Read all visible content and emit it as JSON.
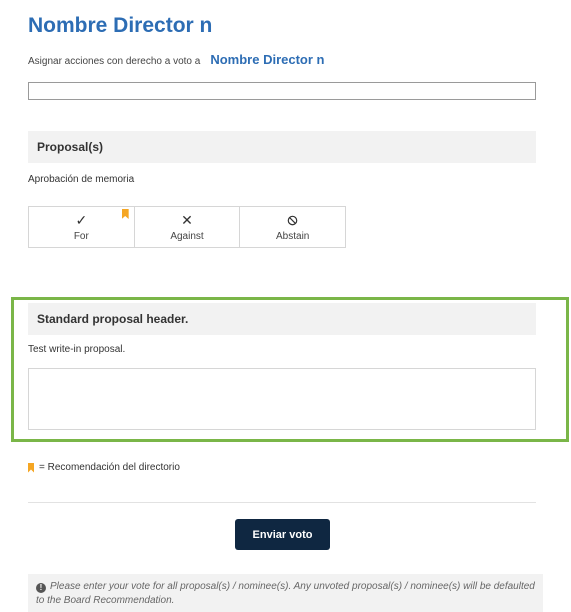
{
  "director": {
    "title": "Nombre Director n",
    "assign_label": "Asignar acciones con derecho a voto a",
    "assign_name": "Nombre Director n",
    "assign_value": ""
  },
  "proposals": {
    "header": "Proposal(s)",
    "item_text": "Aprobación de memoria",
    "vote_options": [
      {
        "label": "For",
        "icon": "check-icon",
        "recommended": true
      },
      {
        "label": "Against",
        "icon": "x-icon",
        "recommended": false
      },
      {
        "label": "Abstain",
        "icon": "ban-icon",
        "recommended": false
      }
    ]
  },
  "standard": {
    "header": "Standard proposal header.",
    "text": "Test write-in proposal.",
    "writein_value": ""
  },
  "legend": {
    "text": "= Recomendación del directorio",
    "icon": "bookmark-icon",
    "color": "#f5a623"
  },
  "submit": {
    "label": "Enviar voto",
    "color": "#0f2741"
  },
  "notice": {
    "icon": "info-icon",
    "text": "Please enter your vote for all proposal(s) / nominee(s). Any unvoted proposal(s) / nominee(s) will be defaulted to the Board Recommendation."
  },
  "colors": {
    "title": "#2d6db4",
    "highlight": "#7ab648"
  }
}
